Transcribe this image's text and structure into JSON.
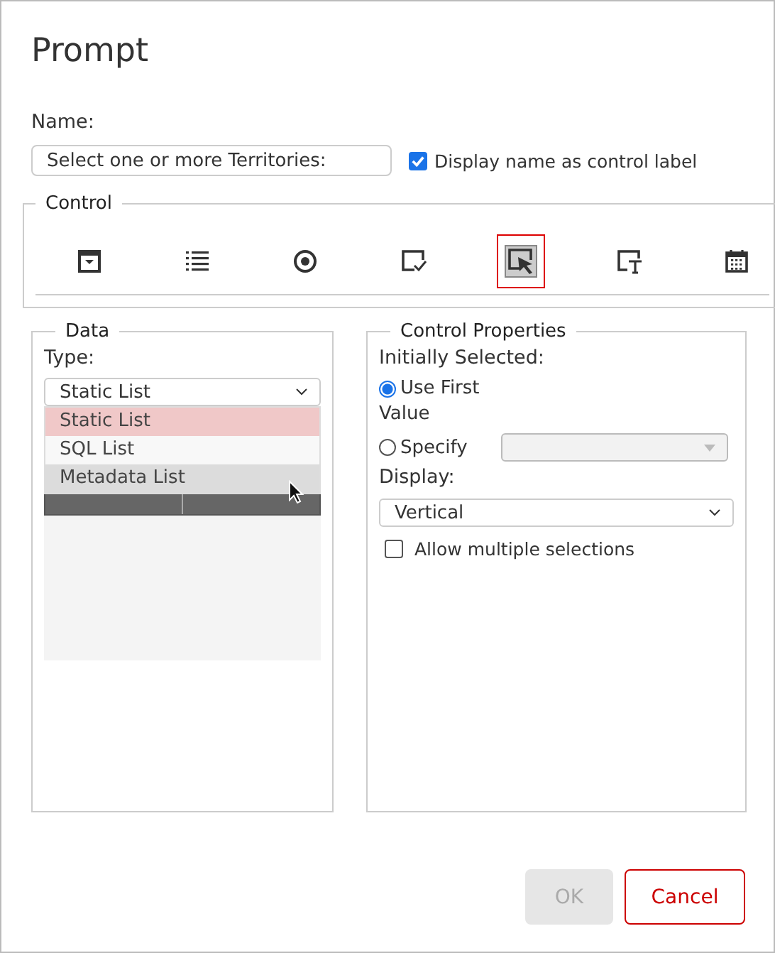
{
  "dialog": {
    "title": "Prompt"
  },
  "name": {
    "label": "Name:",
    "value": "Select one or more Territories:",
    "display_label": {
      "label": "Display name as control label",
      "checked": true
    }
  },
  "control": {
    "legend": "Control",
    "types": [
      {
        "kind": "dropdown",
        "selected": false
      },
      {
        "kind": "list",
        "selected": false
      },
      {
        "kind": "radio",
        "selected": false
      },
      {
        "kind": "checkbox",
        "selected": false
      },
      {
        "kind": "select",
        "selected": true
      },
      {
        "kind": "text",
        "selected": false
      },
      {
        "kind": "date",
        "selected": false
      }
    ]
  },
  "data": {
    "legend": "Data",
    "type_label": "Type:",
    "type_value": "Static List",
    "type_options": [
      {
        "label": "Static List",
        "selected": true,
        "hovered": false
      },
      {
        "label": "SQL List",
        "selected": false,
        "hovered": false
      },
      {
        "label": "Metadata List",
        "selected": false,
        "hovered": true
      }
    ]
  },
  "properties": {
    "legend": "Control Properties",
    "initially_selected_label": "Initially Selected:",
    "options": [
      {
        "label": "Use First",
        "selected": true
      },
      {
        "label": "Value",
        "kind": "note"
      },
      {
        "label": "Specify",
        "selected": false
      }
    ],
    "display_label": "Display:",
    "display_value": "Vertical",
    "allow_multiple": {
      "label": "Allow multiple selections",
      "checked": false
    }
  },
  "buttons": [
    {
      "label": "OK",
      "kind": "primary",
      "disabled": true
    },
    {
      "label": "Cancel",
      "kind": "secondary",
      "disabled": false
    }
  ]
}
